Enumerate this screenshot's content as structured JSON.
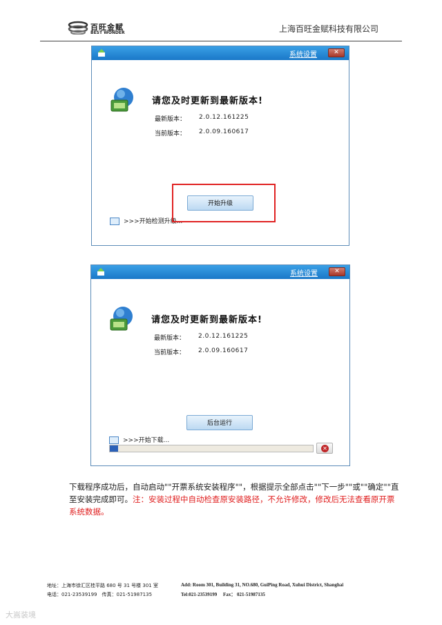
{
  "header": {
    "logo_cn": "百旺金赋",
    "logo_en": "BEST WONDER",
    "company": "上海百旺金赋科技有限公司"
  },
  "dialog1": {
    "settings_link": "系统设置",
    "headline": "请您及时更新到最新版本!",
    "latest_label": "最新版本：",
    "latest_value": "2.0.12.161225",
    "current_label": "当前版本：",
    "current_value": "2.0.09.160617",
    "button_label": "开始升级",
    "status_text": ">>>开始检测升级..."
  },
  "dialog2": {
    "settings_link": "系统设置",
    "headline": "请您及时更新到最新版本!",
    "latest_label": "最新版本：",
    "latest_value": "2.0.12.161225",
    "current_label": "当前版本：",
    "current_value": "2.0.09.160617",
    "button_label": "后台运行",
    "status_text": ">>>开始下载...",
    "progress": 0.04
  },
  "paragraph": {
    "normal": "下载程序成功后，自动启动\"\"开票系统安装程序\"\"，根据提示全部点击\"\"下一步\"\"或\"\"确定\"\"直至安装完成即可。",
    "warning": "注：安装过程中自动检查原安装路径，不允许修改，修改后无法查看原开票系统数据。"
  },
  "footer": {
    "addr_cn": "地址：上海市徐汇区桂平路 680 号 31 号楼 301 室",
    "tel_cn": "电话：021-23539199　传真：021-51987135",
    "addr_en": "Add: Room 301, Building 31, NO.680, GuiPing Road, Xuhui District, Shanghai",
    "tel_en": "Tel:021-23539199　 Fax： 021-51987135"
  },
  "watermark": "大嵩装境",
  "colors": {
    "titlebar": "#1a78c8",
    "highlight": "#e02020",
    "warning_text": "#e02020"
  }
}
